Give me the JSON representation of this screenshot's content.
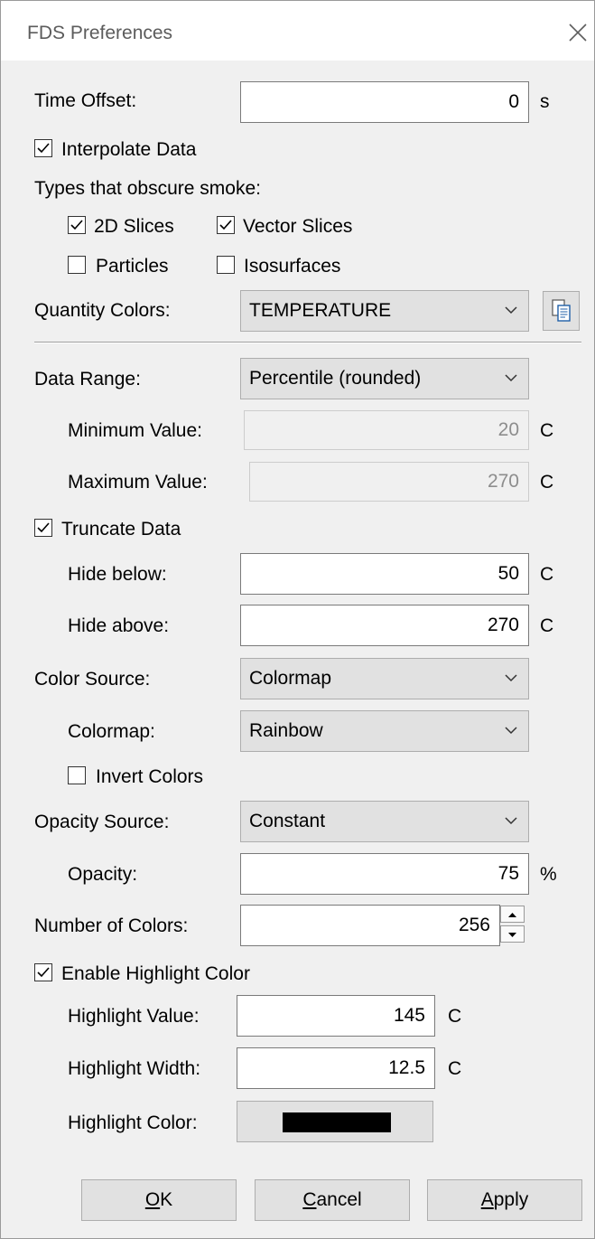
{
  "window": {
    "title": "FDS Preferences"
  },
  "time_offset": {
    "label": "Time Offset:",
    "value": "0",
    "unit": "s"
  },
  "interpolate": {
    "label": "Interpolate Data",
    "checked": true
  },
  "obscure": {
    "heading": "Types that obscure smoke:",
    "items": [
      {
        "label": "2D Slices",
        "checked": true
      },
      {
        "label": "Vector Slices",
        "checked": true
      },
      {
        "label": "Particles",
        "checked": false
      },
      {
        "label": "Isosurfaces",
        "checked": false
      }
    ]
  },
  "quantity": {
    "label": "Quantity Colors:",
    "value": "TEMPERATURE",
    "copy_icon": "copy-icon"
  },
  "data_range": {
    "label": "Data Range:",
    "value": "Percentile (rounded)"
  },
  "minimum": {
    "label": "Minimum Value:",
    "value": "20",
    "unit": "C"
  },
  "maximum": {
    "label": "Maximum Value:",
    "value": "270",
    "unit": "C"
  },
  "truncate": {
    "label": "Truncate Data",
    "checked": true
  },
  "hide_below": {
    "label": "Hide below:",
    "value": "50",
    "unit": "C"
  },
  "hide_above": {
    "label": "Hide above:",
    "value": "270",
    "unit": "C"
  },
  "color_source": {
    "label": "Color Source:",
    "value": "Colormap"
  },
  "colormap": {
    "label": "Colormap:",
    "value": "Rainbow"
  },
  "invert": {
    "label": "Invert Colors",
    "checked": false
  },
  "opacity_source": {
    "label": "Opacity Source:",
    "value": "Constant"
  },
  "opacity": {
    "label": "Opacity:",
    "value": "75",
    "unit": "%"
  },
  "num_colors": {
    "label": "Number of Colors:",
    "value": "256"
  },
  "highlight": {
    "enable_label": "Enable Highlight Color",
    "enabled": true,
    "value_label": "Highlight Value:",
    "value": "145",
    "value_unit": "C",
    "width_label": "Highlight Width:",
    "width": "12.5",
    "width_unit": "C",
    "color_label": "Highlight Color:",
    "color": "#000000"
  },
  "buttons": {
    "ok_mnemonic": "O",
    "ok_rest": "K",
    "cancel_mnemonic": "C",
    "cancel_rest": "ancel",
    "apply_mnemonic": "A",
    "apply_rest": "pply"
  },
  "colors": {
    "window_bg": "#f0f0f0",
    "titlebar_bg": "#ffffff",
    "button_bg": "#e1e1e1"
  }
}
